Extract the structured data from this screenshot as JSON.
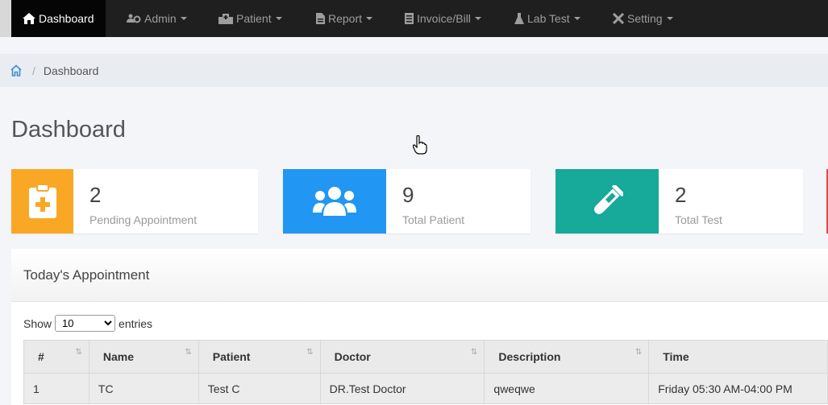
{
  "nav": {
    "items": [
      {
        "label": "Dashboard",
        "icon": "home-icon",
        "active": true
      },
      {
        "label": "Admin",
        "icon": "users-cog-icon"
      },
      {
        "label": "Patient",
        "icon": "hospital-icon"
      },
      {
        "label": "Report",
        "icon": "file-icon"
      },
      {
        "label": "Invoice/Bill",
        "icon": "receipt-icon"
      },
      {
        "label": "Lab Test",
        "icon": "flask-icon"
      },
      {
        "label": "Setting",
        "icon": "tools-icon"
      }
    ]
  },
  "breadcrumb": {
    "current": "Dashboard"
  },
  "page_title": "Dashboard",
  "stats": [
    {
      "value": "2",
      "label": "Pending Appointment",
      "color": "#f9a825",
      "icon": "clipboard-medical-icon"
    },
    {
      "value": "9",
      "label": "Total Patient",
      "color": "#2196f3",
      "icon": "users-icon"
    },
    {
      "value": "2",
      "label": "Total Test",
      "color": "#17a99a",
      "icon": "test-tube-icon"
    }
  ],
  "panel": {
    "title": "Today's Appointment",
    "show_label": "Show",
    "entries_label": "entries",
    "page_size": "10",
    "columns": [
      "#",
      "Name",
      "Patient",
      "Doctor",
      "Description",
      "Time"
    ],
    "rows": [
      [
        "1",
        "TC",
        "Test C",
        "DR.Test Doctor",
        "qweqwe",
        "Friday 05:30 AM-04:00 PM"
      ]
    ]
  }
}
